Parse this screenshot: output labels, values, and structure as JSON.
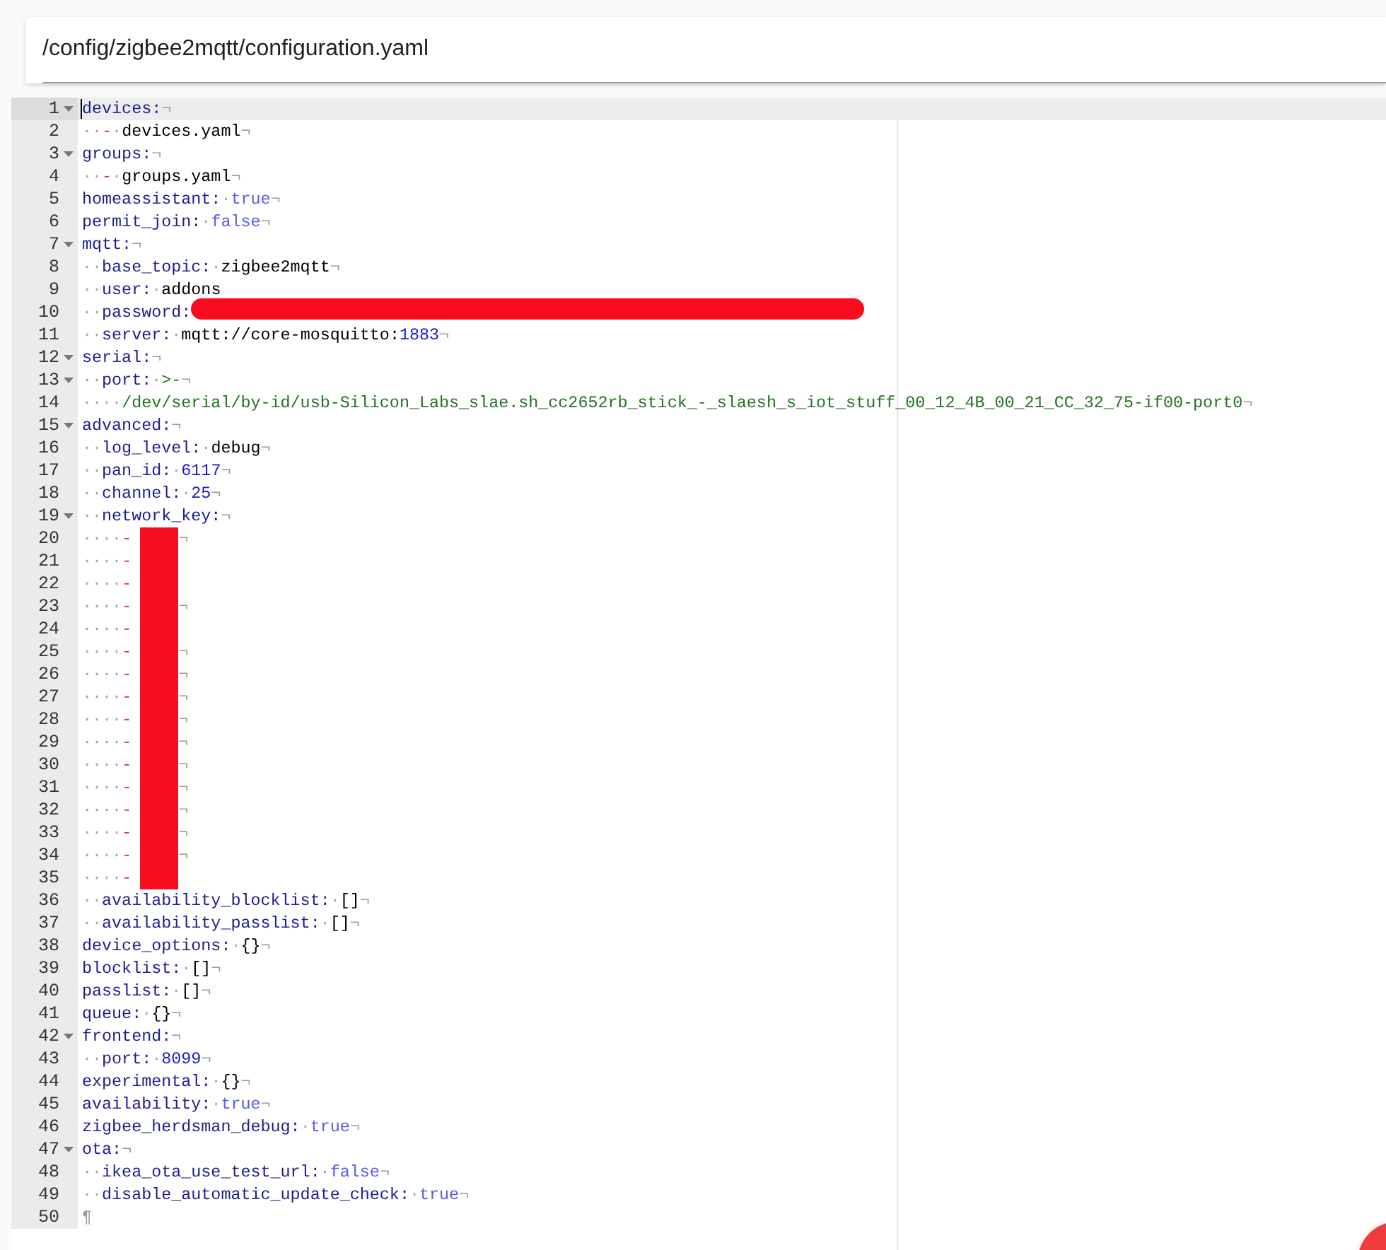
{
  "file_path": "/config/zigbee2mqtt/configuration.yaml",
  "editor": {
    "lines": [
      {
        "number": "1",
        "foldable": true,
        "active": true,
        "tokens": [
          {
            "kind": "key",
            "text": "devices:"
          },
          {
            "kind": "eol",
            "text": "¬"
          }
        ]
      },
      {
        "number": "2",
        "foldable": false,
        "active": false,
        "tokens": [
          {
            "kind": "ws",
            "text": "··"
          },
          {
            "kind": "dash",
            "text": "-"
          },
          {
            "kind": "ws",
            "text": "·"
          },
          {
            "kind": "plain",
            "text": "devices.yaml"
          },
          {
            "kind": "eol",
            "text": "¬"
          }
        ]
      },
      {
        "number": "3",
        "foldable": true,
        "active": false,
        "tokens": [
          {
            "kind": "key",
            "text": "groups:"
          },
          {
            "kind": "eol",
            "text": "¬"
          }
        ]
      },
      {
        "number": "4",
        "foldable": false,
        "active": false,
        "tokens": [
          {
            "kind": "ws",
            "text": "··"
          },
          {
            "kind": "dash",
            "text": "-"
          },
          {
            "kind": "ws",
            "text": "·"
          },
          {
            "kind": "plain",
            "text": "groups.yaml"
          },
          {
            "kind": "eol",
            "text": "¬"
          }
        ]
      },
      {
        "number": "5",
        "foldable": false,
        "active": false,
        "tokens": [
          {
            "kind": "key",
            "text": "homeassistant:"
          },
          {
            "kind": "ws",
            "text": "·"
          },
          {
            "kind": "bool",
            "text": "true"
          },
          {
            "kind": "eol",
            "text": "¬"
          }
        ]
      },
      {
        "number": "6",
        "foldable": false,
        "active": false,
        "tokens": [
          {
            "kind": "key",
            "text": "permit_join:"
          },
          {
            "kind": "ws",
            "text": "·"
          },
          {
            "kind": "bool",
            "text": "false"
          },
          {
            "kind": "eol",
            "text": "¬"
          }
        ]
      },
      {
        "number": "7",
        "foldable": true,
        "active": false,
        "tokens": [
          {
            "kind": "key",
            "text": "mqtt:"
          },
          {
            "kind": "eol",
            "text": "¬"
          }
        ]
      },
      {
        "number": "8",
        "foldable": false,
        "active": false,
        "tokens": [
          {
            "kind": "ws",
            "text": "··"
          },
          {
            "kind": "key",
            "text": "base_topic:"
          },
          {
            "kind": "ws",
            "text": "·"
          },
          {
            "kind": "plain",
            "text": "zigbee2mqtt"
          },
          {
            "kind": "eol",
            "text": "¬"
          }
        ]
      },
      {
        "number": "9",
        "foldable": false,
        "active": false,
        "tokens": [
          {
            "kind": "ws",
            "text": "··"
          },
          {
            "kind": "key",
            "text": "user:"
          },
          {
            "kind": "ws",
            "text": "·"
          },
          {
            "kind": "plain",
            "text": "addons"
          }
        ]
      },
      {
        "number": "10",
        "foldable": false,
        "active": false,
        "tokens": [
          {
            "kind": "ws",
            "text": "··"
          },
          {
            "kind": "key",
            "text": "password:"
          },
          {
            "kind": "redaction_pill"
          }
        ]
      },
      {
        "number": "11",
        "foldable": false,
        "active": false,
        "tokens": [
          {
            "kind": "ws",
            "text": "··"
          },
          {
            "kind": "key",
            "text": "server:"
          },
          {
            "kind": "ws",
            "text": "·"
          },
          {
            "kind": "plain",
            "text": "mqtt://core-mosquitto:"
          },
          {
            "kind": "number",
            "text": "1883"
          },
          {
            "kind": "eol",
            "text": "¬"
          }
        ]
      },
      {
        "number": "12",
        "foldable": true,
        "active": false,
        "tokens": [
          {
            "kind": "key",
            "text": "serial:"
          },
          {
            "kind": "eol",
            "text": "¬"
          }
        ]
      },
      {
        "number": "13",
        "foldable": true,
        "active": false,
        "tokens": [
          {
            "kind": "ws",
            "text": "··"
          },
          {
            "kind": "key",
            "text": "port:"
          },
          {
            "kind": "ws",
            "text": "·"
          },
          {
            "kind": "string",
            "text": ">-"
          },
          {
            "kind": "eol",
            "text": "¬"
          }
        ]
      },
      {
        "number": "14",
        "foldable": false,
        "active": false,
        "tokens": [
          {
            "kind": "ws",
            "text": "····"
          },
          {
            "kind": "string",
            "text": "/dev/serial/by-id/usb-Silicon_Labs_slae.sh_cc2652rb_stick_-_slaesh_s_iot_stuff_00_12_4B_00_21_CC_32_75-if00-port0"
          },
          {
            "kind": "eol",
            "text": "¬"
          }
        ]
      },
      {
        "number": "15",
        "foldable": true,
        "active": false,
        "tokens": [
          {
            "kind": "key",
            "text": "advanced:"
          },
          {
            "kind": "eol",
            "text": "¬"
          }
        ]
      },
      {
        "number": "16",
        "foldable": false,
        "active": false,
        "tokens": [
          {
            "kind": "ws",
            "text": "··"
          },
          {
            "kind": "key",
            "text": "log_level:"
          },
          {
            "kind": "ws",
            "text": "·"
          },
          {
            "kind": "plain",
            "text": "debug"
          },
          {
            "kind": "eol",
            "text": "¬"
          }
        ]
      },
      {
        "number": "17",
        "foldable": false,
        "active": false,
        "tokens": [
          {
            "kind": "ws",
            "text": "··"
          },
          {
            "kind": "key",
            "text": "pan_id:"
          },
          {
            "kind": "ws",
            "text": "·"
          },
          {
            "kind": "number",
            "text": "6117"
          },
          {
            "kind": "eol",
            "text": "¬"
          }
        ]
      },
      {
        "number": "18",
        "foldable": false,
        "active": false,
        "tokens": [
          {
            "kind": "ws",
            "text": "··"
          },
          {
            "kind": "key",
            "text": "channel:"
          },
          {
            "kind": "ws",
            "text": "·"
          },
          {
            "kind": "number",
            "text": "25"
          },
          {
            "kind": "eol",
            "text": "¬"
          }
        ]
      },
      {
        "number": "19",
        "foldable": true,
        "active": false,
        "tokens": [
          {
            "kind": "ws",
            "text": "··"
          },
          {
            "kind": "key",
            "text": "network_key:"
          },
          {
            "kind": "eol",
            "text": "¬"
          }
        ]
      },
      {
        "number": "20",
        "foldable": false,
        "active": false,
        "tokens": [
          {
            "kind": "ws",
            "text": "····"
          },
          {
            "kind": "dash",
            "text": "-"
          },
          {
            "kind": "redaction_block"
          },
          {
            "kind": "eol",
            "text": "¬"
          }
        ]
      },
      {
        "number": "21",
        "foldable": false,
        "active": false,
        "tokens": [
          {
            "kind": "ws",
            "text": "····"
          },
          {
            "kind": "dash",
            "text": "-"
          },
          {
            "kind": "redaction_block"
          }
        ]
      },
      {
        "number": "22",
        "foldable": false,
        "active": false,
        "tokens": [
          {
            "kind": "ws",
            "text": "····"
          },
          {
            "kind": "dash",
            "text": "-"
          },
          {
            "kind": "redaction_block"
          }
        ]
      },
      {
        "number": "23",
        "foldable": false,
        "active": false,
        "tokens": [
          {
            "kind": "ws",
            "text": "····"
          },
          {
            "kind": "dash",
            "text": "-"
          },
          {
            "kind": "redaction_block"
          },
          {
            "kind": "eol",
            "text": "¬"
          }
        ]
      },
      {
        "number": "24",
        "foldable": false,
        "active": false,
        "tokens": [
          {
            "kind": "ws",
            "text": "····"
          },
          {
            "kind": "dash",
            "text": "-"
          },
          {
            "kind": "redaction_block"
          }
        ]
      },
      {
        "number": "25",
        "foldable": false,
        "active": false,
        "tokens": [
          {
            "kind": "ws",
            "text": "····"
          },
          {
            "kind": "dash",
            "text": "-"
          },
          {
            "kind": "redaction_block"
          },
          {
            "kind": "eol",
            "text": "¬"
          }
        ]
      },
      {
        "number": "26",
        "foldable": false,
        "active": false,
        "tokens": [
          {
            "kind": "ws",
            "text": "····"
          },
          {
            "kind": "dash",
            "text": "-"
          },
          {
            "kind": "redaction_block"
          },
          {
            "kind": "eol",
            "text": "¬"
          }
        ]
      },
      {
        "number": "27",
        "foldable": false,
        "active": false,
        "tokens": [
          {
            "kind": "ws",
            "text": "····"
          },
          {
            "kind": "dash",
            "text": "-"
          },
          {
            "kind": "redaction_block"
          },
          {
            "kind": "eol",
            "text": "¬"
          }
        ]
      },
      {
        "number": "28",
        "foldable": false,
        "active": false,
        "tokens": [
          {
            "kind": "ws",
            "text": "····"
          },
          {
            "kind": "dash",
            "text": "-"
          },
          {
            "kind": "redaction_block"
          },
          {
            "kind": "eol",
            "text": "¬"
          }
        ]
      },
      {
        "number": "29",
        "foldable": false,
        "active": false,
        "tokens": [
          {
            "kind": "ws",
            "text": "····"
          },
          {
            "kind": "dash",
            "text": "-"
          },
          {
            "kind": "redaction_block"
          },
          {
            "kind": "eol",
            "text": "¬"
          }
        ]
      },
      {
        "number": "30",
        "foldable": false,
        "active": false,
        "tokens": [
          {
            "kind": "ws",
            "text": "····"
          },
          {
            "kind": "dash",
            "text": "-"
          },
          {
            "kind": "redaction_block"
          },
          {
            "kind": "eol",
            "text": "¬"
          }
        ]
      },
      {
        "number": "31",
        "foldable": false,
        "active": false,
        "tokens": [
          {
            "kind": "ws",
            "text": "····"
          },
          {
            "kind": "dash",
            "text": "-"
          },
          {
            "kind": "redaction_block"
          },
          {
            "kind": "eol",
            "text": "¬"
          }
        ]
      },
      {
        "number": "32",
        "foldable": false,
        "active": false,
        "tokens": [
          {
            "kind": "ws",
            "text": "····"
          },
          {
            "kind": "dash",
            "text": "-"
          },
          {
            "kind": "redaction_block"
          },
          {
            "kind": "eol",
            "text": "¬"
          }
        ]
      },
      {
        "number": "33",
        "foldable": false,
        "active": false,
        "tokens": [
          {
            "kind": "ws",
            "text": "····"
          },
          {
            "kind": "dash",
            "text": "-"
          },
          {
            "kind": "redaction_block"
          },
          {
            "kind": "eol",
            "text": "¬"
          }
        ]
      },
      {
        "number": "34",
        "foldable": false,
        "active": false,
        "tokens": [
          {
            "kind": "ws",
            "text": "····"
          },
          {
            "kind": "dash",
            "text": "-"
          },
          {
            "kind": "redaction_block"
          },
          {
            "kind": "eol",
            "text": "¬"
          }
        ]
      },
      {
        "number": "35",
        "foldable": false,
        "active": false,
        "tokens": [
          {
            "kind": "ws",
            "text": "····"
          },
          {
            "kind": "dash",
            "text": "-"
          },
          {
            "kind": "redaction_block"
          }
        ]
      },
      {
        "number": "36",
        "foldable": false,
        "active": false,
        "tokens": [
          {
            "kind": "ws",
            "text": "··"
          },
          {
            "kind": "key",
            "text": "availability_blocklist:"
          },
          {
            "kind": "ws",
            "text": "·"
          },
          {
            "kind": "plain",
            "text": "[]"
          },
          {
            "kind": "eol",
            "text": "¬"
          }
        ]
      },
      {
        "number": "37",
        "foldable": false,
        "active": false,
        "tokens": [
          {
            "kind": "ws",
            "text": "··"
          },
          {
            "kind": "key",
            "text": "availability_passlist:"
          },
          {
            "kind": "ws",
            "text": "·"
          },
          {
            "kind": "plain",
            "text": "[]"
          },
          {
            "kind": "eol",
            "text": "¬"
          }
        ]
      },
      {
        "number": "38",
        "foldable": false,
        "active": false,
        "tokens": [
          {
            "kind": "key",
            "text": "device_options:"
          },
          {
            "kind": "ws",
            "text": "·"
          },
          {
            "kind": "plain",
            "text": "{}"
          },
          {
            "kind": "eol",
            "text": "¬"
          }
        ]
      },
      {
        "number": "39",
        "foldable": false,
        "active": false,
        "tokens": [
          {
            "kind": "key",
            "text": "blocklist:"
          },
          {
            "kind": "ws",
            "text": "·"
          },
          {
            "kind": "plain",
            "text": "[]"
          },
          {
            "kind": "eol",
            "text": "¬"
          }
        ]
      },
      {
        "number": "40",
        "foldable": false,
        "active": false,
        "tokens": [
          {
            "kind": "key",
            "text": "passlist:"
          },
          {
            "kind": "ws",
            "text": "·"
          },
          {
            "kind": "plain",
            "text": "[]"
          },
          {
            "kind": "eol",
            "text": "¬"
          }
        ]
      },
      {
        "number": "41",
        "foldable": false,
        "active": false,
        "tokens": [
          {
            "kind": "key",
            "text": "queue:"
          },
          {
            "kind": "ws",
            "text": "·"
          },
          {
            "kind": "plain",
            "text": "{}"
          },
          {
            "kind": "eol",
            "text": "¬"
          }
        ]
      },
      {
        "number": "42",
        "foldable": true,
        "active": false,
        "tokens": [
          {
            "kind": "key",
            "text": "frontend:"
          },
          {
            "kind": "eol",
            "text": "¬"
          }
        ]
      },
      {
        "number": "43",
        "foldable": false,
        "active": false,
        "tokens": [
          {
            "kind": "ws",
            "text": "··"
          },
          {
            "kind": "key",
            "text": "port:"
          },
          {
            "kind": "ws",
            "text": "·"
          },
          {
            "kind": "number",
            "text": "8099"
          },
          {
            "kind": "eol",
            "text": "¬"
          }
        ]
      },
      {
        "number": "44",
        "foldable": false,
        "active": false,
        "tokens": [
          {
            "kind": "key",
            "text": "experimental:"
          },
          {
            "kind": "ws",
            "text": "·"
          },
          {
            "kind": "plain",
            "text": "{}"
          },
          {
            "kind": "eol",
            "text": "¬"
          }
        ]
      },
      {
        "number": "45",
        "foldable": false,
        "active": false,
        "tokens": [
          {
            "kind": "key",
            "text": "availability:"
          },
          {
            "kind": "ws",
            "text": "·"
          },
          {
            "kind": "bool",
            "text": "true"
          },
          {
            "kind": "eol",
            "text": "¬"
          }
        ]
      },
      {
        "number": "46",
        "foldable": false,
        "active": false,
        "tokens": [
          {
            "kind": "key",
            "text": "zigbee_herdsman_debug:"
          },
          {
            "kind": "ws",
            "text": "·"
          },
          {
            "kind": "bool",
            "text": "true"
          },
          {
            "kind": "eol",
            "text": "¬"
          }
        ]
      },
      {
        "number": "47",
        "foldable": true,
        "active": false,
        "tokens": [
          {
            "kind": "key",
            "text": "ota:"
          },
          {
            "kind": "eol",
            "text": "¬"
          }
        ]
      },
      {
        "number": "48",
        "foldable": false,
        "active": false,
        "tokens": [
          {
            "kind": "ws",
            "text": "··"
          },
          {
            "kind": "key",
            "text": "ikea_ota_use_test_url:"
          },
          {
            "kind": "ws",
            "text": "·"
          },
          {
            "kind": "bool",
            "text": "false"
          },
          {
            "kind": "eol",
            "text": "¬"
          }
        ]
      },
      {
        "number": "49",
        "foldable": false,
        "active": false,
        "tokens": [
          {
            "kind": "ws",
            "text": "··"
          },
          {
            "kind": "key",
            "text": "disable_automatic_update_check:"
          },
          {
            "kind": "ws",
            "text": "·"
          },
          {
            "kind": "bool",
            "text": "true"
          },
          {
            "kind": "eol",
            "text": "¬"
          }
        ]
      },
      {
        "number": "50",
        "foldable": false,
        "active": false,
        "tokens": [
          {
            "kind": "eol",
            "text": "¶"
          }
        ]
      }
    ]
  }
}
